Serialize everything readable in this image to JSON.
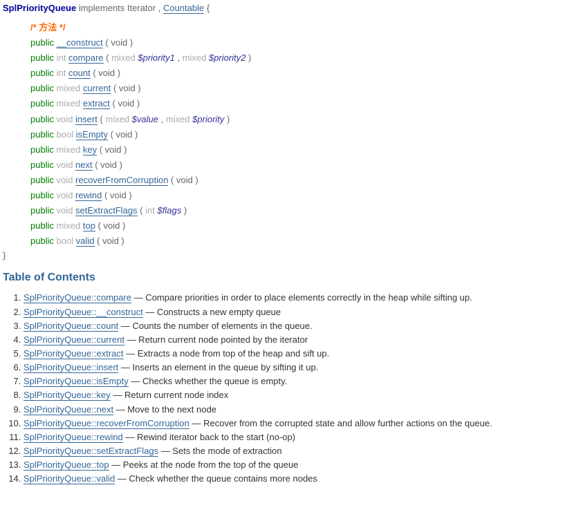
{
  "synopsis": {
    "className": "SplPriorityQueue",
    "implements": "implements",
    "iterator": "Iterator",
    "sep": ",",
    "countable": "Countable",
    "openBrace": "{",
    "comment": "/* 方法 */",
    "closeBrace": "}"
  },
  "methods": [
    {
      "modifier": "public",
      "type": "",
      "name": "__construct",
      "params": " ( void )"
    },
    {
      "modifier": "public",
      "type": "int",
      "name": "compare",
      "paramsParts": [
        {
          "paren": " ( "
        },
        {
          "ptype": "mixed "
        },
        {
          "pname": "$priority1"
        },
        {
          "paren": " , "
        },
        {
          "ptype": "mixed "
        },
        {
          "pname": "$priority2"
        },
        {
          "paren": " )"
        }
      ]
    },
    {
      "modifier": "public",
      "type": "int",
      "name": "count",
      "params": " ( void )"
    },
    {
      "modifier": "public",
      "type": "mixed",
      "name": "current",
      "params": " ( void )"
    },
    {
      "modifier": "public",
      "type": "mixed",
      "name": "extract",
      "params": " ( void )"
    },
    {
      "modifier": "public",
      "type": "void",
      "name": "insert",
      "paramsParts": [
        {
          "paren": " ( "
        },
        {
          "ptype": "mixed "
        },
        {
          "pname": "$value"
        },
        {
          "paren": " , "
        },
        {
          "ptype": "mixed "
        },
        {
          "pname": "$priority"
        },
        {
          "paren": " )"
        }
      ]
    },
    {
      "modifier": "public",
      "type": "bool",
      "name": "isEmpty",
      "params": " ( void )"
    },
    {
      "modifier": "public",
      "type": "mixed",
      "name": "key",
      "params": " ( void )"
    },
    {
      "modifier": "public",
      "type": "void",
      "name": "next",
      "params": " ( void )"
    },
    {
      "modifier": "public",
      "type": "void",
      "name": "recoverFromCorruption",
      "params": " ( void )"
    },
    {
      "modifier": "public",
      "type": "void",
      "name": "rewind",
      "params": " ( void )"
    },
    {
      "modifier": "public",
      "type": "void",
      "name": "setExtractFlags",
      "paramsParts": [
        {
          "paren": " ( "
        },
        {
          "ptype": "int "
        },
        {
          "pname": "$flags"
        },
        {
          "paren": " )"
        }
      ]
    },
    {
      "modifier": "public",
      "type": "mixed",
      "name": "top",
      "params": " ( void )"
    },
    {
      "modifier": "public",
      "type": "bool",
      "name": "valid",
      "params": " ( void )"
    }
  ],
  "toc": {
    "heading": "Table of Contents",
    "items": [
      {
        "link": "SplPriorityQueue::compare",
        "desc": " — Compare priorities in order to place elements correctly in the heap while sifting up."
      },
      {
        "link": "SplPriorityQueue::__construct",
        "desc": " — Constructs a new empty queue"
      },
      {
        "link": "SplPriorityQueue::count",
        "desc": " — Counts the number of elements in the queue."
      },
      {
        "link": "SplPriorityQueue::current",
        "desc": " — Return current node pointed by the iterator"
      },
      {
        "link": "SplPriorityQueue::extract",
        "desc": " — Extracts a node from top of the heap and sift up."
      },
      {
        "link": "SplPriorityQueue::insert",
        "desc": " — Inserts an element in the queue by sifting it up."
      },
      {
        "link": "SplPriorityQueue::isEmpty",
        "desc": " — Checks whether the queue is empty."
      },
      {
        "link": "SplPriorityQueue::key",
        "desc": " — Return current node index"
      },
      {
        "link": "SplPriorityQueue::next",
        "desc": " — Move to the next node"
      },
      {
        "link": "SplPriorityQueue::recoverFromCorruption",
        "desc": " — Recover from the corrupted state and allow further actions on the queue."
      },
      {
        "link": "SplPriorityQueue::rewind",
        "desc": " — Rewind iterator back to the start (no-op)"
      },
      {
        "link": "SplPriorityQueue::setExtractFlags",
        "desc": " — Sets the mode of extraction"
      },
      {
        "link": "SplPriorityQueue::top",
        "desc": " — Peeks at the node from the top of the queue"
      },
      {
        "link": "SplPriorityQueue::valid",
        "desc": " — Check whether the queue contains more nodes"
      }
    ]
  }
}
